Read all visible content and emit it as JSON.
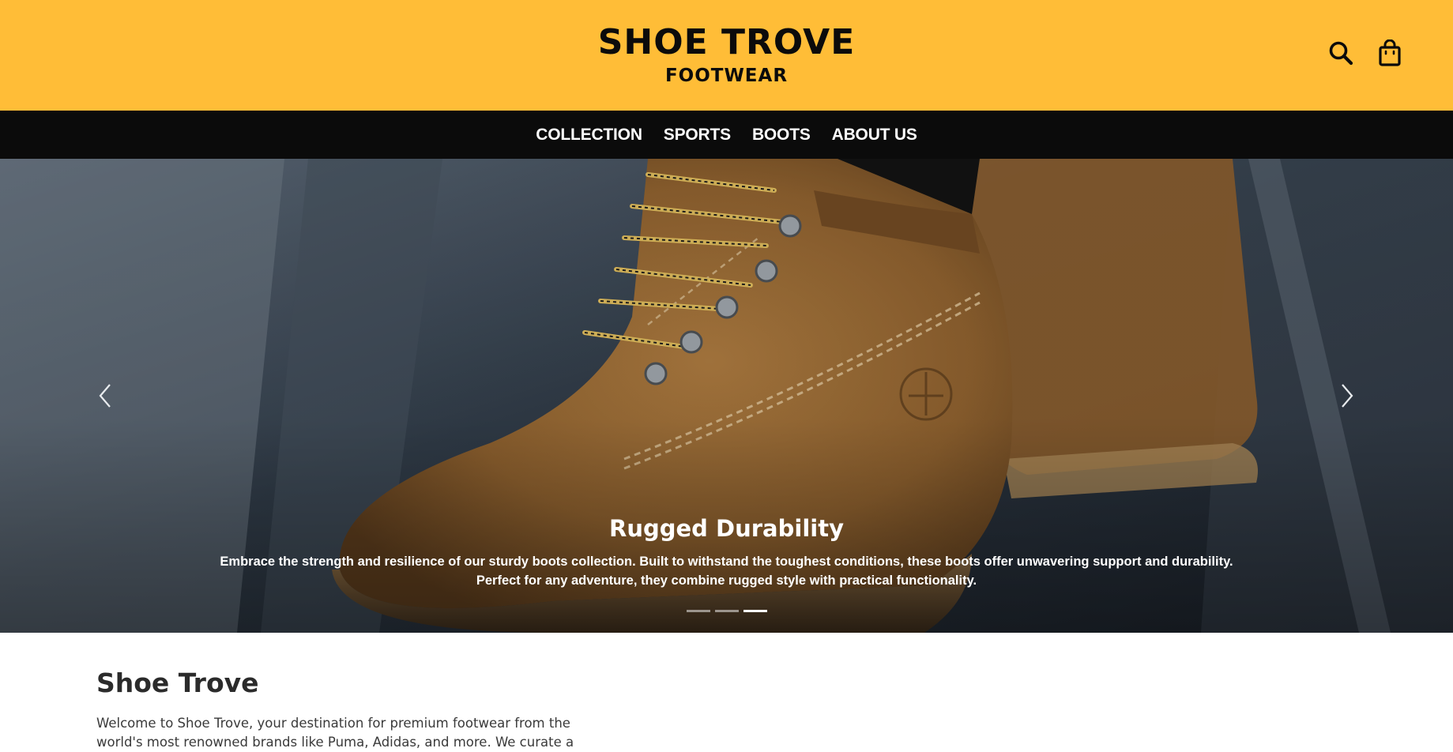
{
  "header": {
    "title": "SHOE TROVE",
    "subtitle": "FOOTWEAR",
    "icons": [
      "search-icon",
      "shopping-bag-icon"
    ],
    "background_color": "#ffbd37"
  },
  "nav": {
    "items": [
      {
        "label": "COLLECTION"
      },
      {
        "label": "SPORTS"
      },
      {
        "label": "BOOTS"
      },
      {
        "label": "ABOUT US"
      }
    ],
    "background_color": "#0b0b0b"
  },
  "hero": {
    "slide_title": "Rugged Durability",
    "slide_text_line1": "Embrace the strength and resilience of our sturdy boots collection. Built to withstand the toughest conditions, these boots offer unwavering support and durability.",
    "slide_text_line2": "Perfect for any adventure, they combine rugged style with practical functionality.",
    "slide_count": 3,
    "active_slide": 3,
    "prev_icon": "chevron-left-icon",
    "next_icon": "chevron-right-icon"
  },
  "about": {
    "title": "Shoe Trove",
    "text": "Welcome to Shoe Trove, your destination for premium footwear from the world's most renowned brands like Puma, Adidas, and more. We curate a"
  }
}
